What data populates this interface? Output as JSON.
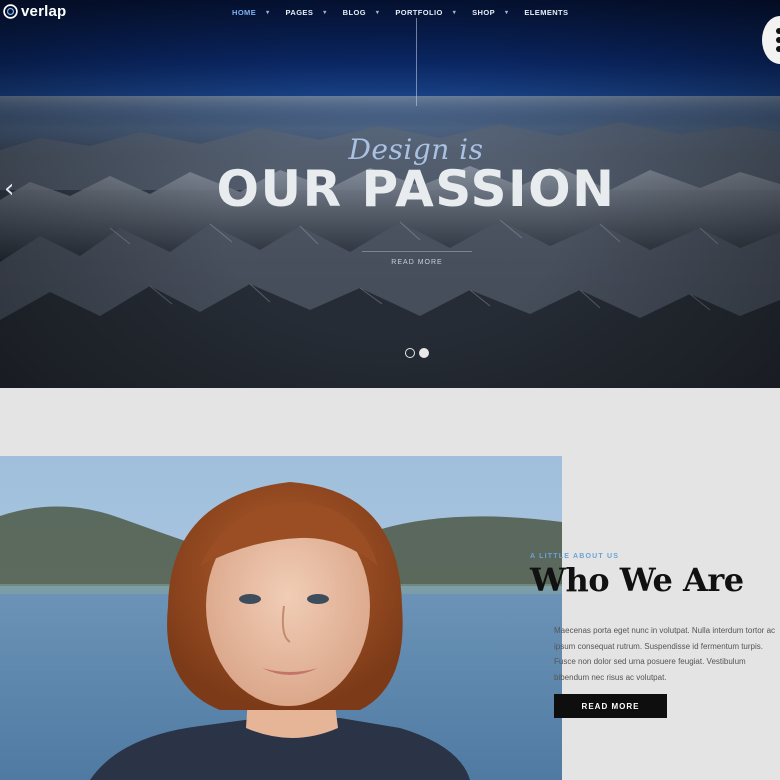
{
  "brand": {
    "name": "verlap"
  },
  "nav": {
    "items": [
      {
        "label": "HOME",
        "has_dropdown": true,
        "active": true
      },
      {
        "label": "PAGES",
        "has_dropdown": true
      },
      {
        "label": "BLOG",
        "has_dropdown": true
      },
      {
        "label": "PORTFOLIO",
        "has_dropdown": true
      },
      {
        "label": "SHOP",
        "has_dropdown": true
      },
      {
        "label": "ELEMENTS",
        "has_dropdown": false
      }
    ]
  },
  "hero": {
    "kicker": "Design is",
    "title": "OUR PASSION",
    "cta": "READ MORE",
    "slides_total": 2,
    "active_slide": 2
  },
  "about": {
    "kicker": "A LITTLE ABOUT US",
    "title": "Who We Are",
    "text": "Maecenas porta eget nunc in volutpat. Nulla interdum tortor ac ipsum consequat rutrum. Suspendisse id fermentum turpis. Fusce non dolor sed urna posuere feugiat. Vestibulum bibendum nec risus ac volutpat.",
    "button": "READ MORE"
  },
  "icons": {
    "logo": "ring-logo-icon",
    "prev": "chevron-left-icon",
    "caret": "caret-down-icon",
    "side": "dots-menu-icon"
  },
  "colors": {
    "accent": "#7fb3f0",
    "button": "#0e0e0e",
    "background": "#e4e4e4"
  }
}
